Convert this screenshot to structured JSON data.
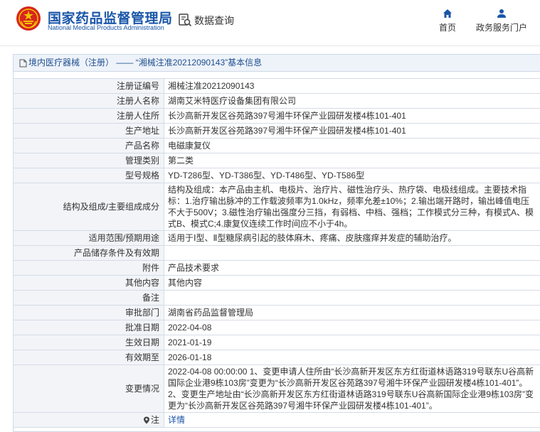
{
  "header": {
    "logo_cn": "国家药品监督管理局",
    "logo_en": "National Medical Products Administration",
    "query_label": "数据查询",
    "nav_home": "首页",
    "nav_portal": "政务服务门户"
  },
  "breadcrumb": {
    "category": "境内医疗器械（注册）",
    "separator": "——",
    "title": "“湘械注准20212090143”基本信息"
  },
  "rows": [
    {
      "label": "注册证编号",
      "value": "湘械注准20212090143"
    },
    {
      "label": "注册人名称",
      "value": "湖南艾米特医疗设备集团有限公司"
    },
    {
      "label": "注册人住所",
      "value": "长沙高新开发区谷苑路397号湘牛环保产业园研发楼4栋101-401"
    },
    {
      "label": "生产地址",
      "value": "长沙高新开发区谷苑路397号湘牛环保产业园研发楼4栋101-401"
    },
    {
      "label": "产品名称",
      "value": "电磁康复仪"
    },
    {
      "label": "管理类别",
      "value": "第二类"
    },
    {
      "label": "型号规格",
      "value": "YD-T286型、YD-T386型、YD-T486型、YD-T586型"
    },
    {
      "label": "结构及组成/主要组成成分",
      "value": "结构及组成：本产品由主机、电极片、治疗片、磁性治疗头、热疗袋、电极线组成。主要技术指标：1.治疗输出脉冲的工作载波频率为1.0kHz，频率允差±10%；2.输出端开路时，输出峰值电压不大于500V；3.磁性治疗输出强度分三挡，有弱档、中档、强档；工作模式分三种，有模式A、模式B、模式C;4.康复仪连续工作时间应不小于4h。"
    },
    {
      "label": "适用范围/预期用途",
      "value": "适用于Ⅰ型、Ⅱ型糖尿病引起的肢体麻木、疼痛、皮肤瘙痒并发症的辅助治疗。"
    },
    {
      "label": "产品储存条件及有效期",
      "value": ""
    },
    {
      "label": "附件",
      "value": "产品技术要求"
    },
    {
      "label": "其他内容",
      "value": "其他内容"
    },
    {
      "label": "备注",
      "value": ""
    },
    {
      "label": "审批部门",
      "value": "湖南省药品监督管理局"
    },
    {
      "label": "批准日期",
      "value": "2022-04-08"
    },
    {
      "label": "生效日期",
      "value": "2021-01-19"
    },
    {
      "label": "有效期至",
      "value": "2026-01-18"
    },
    {
      "label": "变更情况",
      "value": "2022-04-08 00:00:00 1、变更申请人住所由“长沙高新开发区东方红街道林语路319号联东U谷高新国际企业港9栋103房”变更为“长沙高新开发区谷苑路397号湘牛环保产业园研发楼4栋101-401”。2、变更生产地址由“长沙高新开发区东方红街道林语路319号联东U谷高新国际企业港9栋103房”变更为“长沙高新开发区谷苑路397号湘牛环保产业园研发楼4栋101-401”。"
    },
    {
      "label": "注",
      "value": "详情"
    }
  ],
  "colors": {
    "brand_blue": "#1a56a8",
    "label_bg": "#f2f4f8",
    "header_bg": "#eef3fa",
    "emblem_red": "#d7261e",
    "emblem_gold": "#f4c400"
  }
}
